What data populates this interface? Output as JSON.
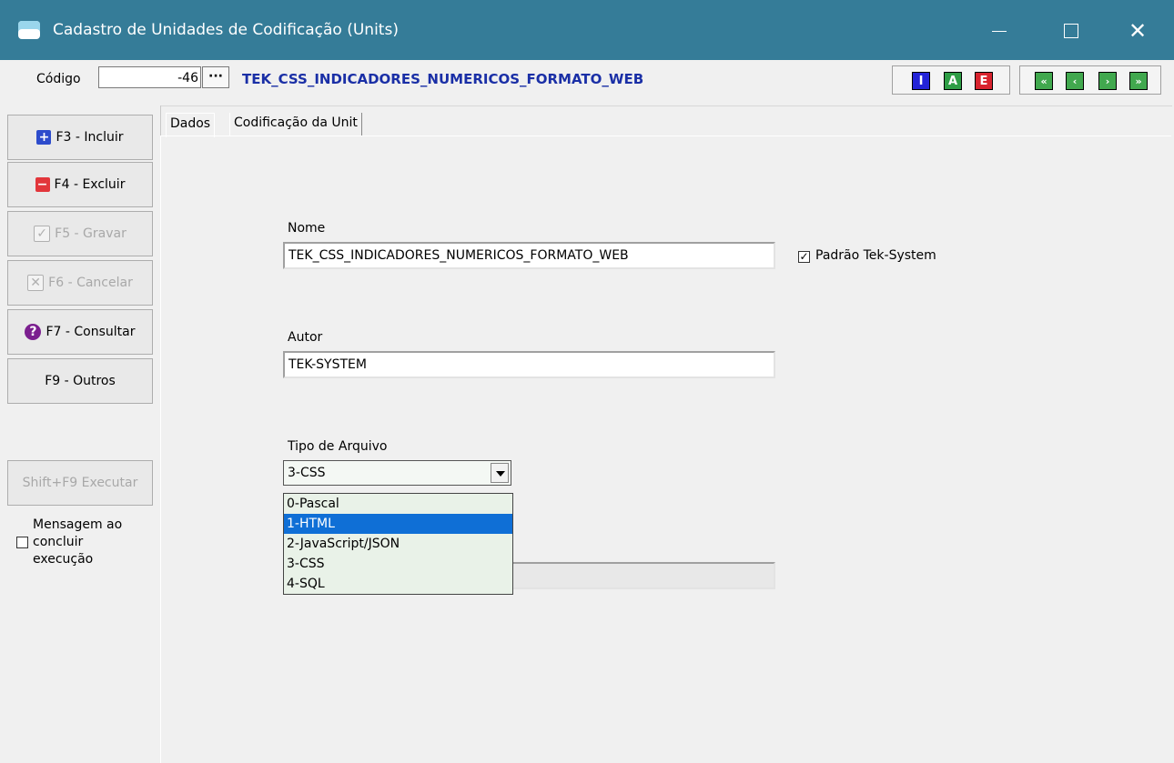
{
  "window": {
    "title": "Cadastro de Unidades de Codificação (Units)",
    "min_glyph": "—",
    "max_glyph": "□",
    "close_glyph": "✕"
  },
  "header": {
    "codigo_label": "Código",
    "codigo_value": "-46",
    "codigo_button": "···",
    "unit_title": "TEK_CSS_INDICADORES_NUMERICOS_FORMATO_WEB",
    "toolbar_a": [
      "I",
      "A",
      "E"
    ],
    "toolbar_nav": [
      "«",
      "‹",
      "›",
      "»"
    ]
  },
  "sidebar": {
    "incluir": "F3 - Incluir",
    "excluir": "F4 - Excluir",
    "gravar": "F5 - Gravar",
    "cancelar": "F6 - Cancelar",
    "consultar": "F7 - Consultar",
    "outros": "F9 - Outros",
    "executar": "Shift+F9 Executar",
    "mensagem": [
      "Mensagem ao",
      "concluir",
      "execução"
    ]
  },
  "tabs": [
    "Dados",
    "Codificação da Unit"
  ],
  "form": {
    "nome_label": "Nome",
    "nome_value": "TEK_CSS_INDICADORES_NUMERICOS_FORMATO_WEB",
    "padrao_label": "Padrão Tek-System",
    "padrao_checked": true,
    "autor_label": "Autor",
    "autor_value": "TEK-SYSTEM",
    "tipo_label": "Tipo de Arquivo",
    "tipo_selected": "3-CSS",
    "tipo_options": [
      "0-Pascal",
      "1-HTML",
      "2-JavaScript/JSON",
      "3-CSS",
      "4-SQL"
    ],
    "tipo_highlighted": "1-HTML"
  },
  "colors": {
    "titlebar": "#357c98",
    "unit_title": "#1a2fa6",
    "selection": "#0f6fd6"
  }
}
